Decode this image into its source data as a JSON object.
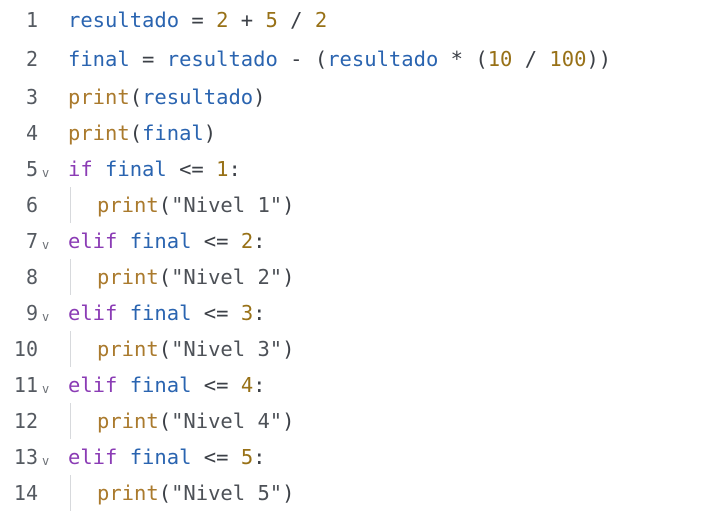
{
  "editor": {
    "lines": [
      {
        "num": "1",
        "fold": "",
        "tokens": [
          {
            "t": "resultado",
            "c": "var"
          },
          {
            "t": " = ",
            "c": "op"
          },
          {
            "t": "2",
            "c": "num"
          },
          {
            "t": " + ",
            "c": "op"
          },
          {
            "t": "5",
            "c": "num"
          },
          {
            "t": " / ",
            "c": "op"
          },
          {
            "t": "2",
            "c": "num"
          }
        ]
      },
      {
        "num": "2",
        "fold": "",
        "tokens": [
          {
            "t": "final",
            "c": "var"
          },
          {
            "t": " = ",
            "c": "op"
          },
          {
            "t": "resultado",
            "c": "var"
          },
          {
            "t": " - ",
            "c": "op"
          },
          {
            "t": "(",
            "c": "punct"
          },
          {
            "t": "resultado",
            "c": "var"
          },
          {
            "t": " * ",
            "c": "op"
          },
          {
            "t": "(",
            "c": "punct"
          },
          {
            "t": "10",
            "c": "num"
          },
          {
            "t": " / ",
            "c": "op"
          },
          {
            "t": "100",
            "c": "num"
          },
          {
            "t": "))",
            "c": "punct"
          }
        ]
      },
      {
        "num": "3",
        "fold": "",
        "tokens": [
          {
            "t": "print",
            "c": "fn"
          },
          {
            "t": "(",
            "c": "punct"
          },
          {
            "t": "resultado",
            "c": "var"
          },
          {
            "t": ")",
            "c": "punct"
          }
        ]
      },
      {
        "num": "4",
        "fold": "",
        "tokens": [
          {
            "t": "print",
            "c": "fn"
          },
          {
            "t": "(",
            "c": "punct"
          },
          {
            "t": "final",
            "c": "var"
          },
          {
            "t": ")",
            "c": "punct"
          }
        ]
      },
      {
        "num": "5",
        "fold": "v",
        "tokens": [
          {
            "t": "if",
            "c": "kw"
          },
          {
            "t": " ",
            "c": "op"
          },
          {
            "t": "final",
            "c": "var"
          },
          {
            "t": " <= ",
            "c": "op"
          },
          {
            "t": "1",
            "c": "num"
          },
          {
            "t": ":",
            "c": "punct"
          }
        ]
      },
      {
        "num": "6",
        "fold": "",
        "indent": true,
        "tokens": [
          {
            "t": "print",
            "c": "fn"
          },
          {
            "t": "(",
            "c": "punct"
          },
          {
            "t": "\"Nivel 1\"",
            "c": "str"
          },
          {
            "t": ")",
            "c": "punct"
          }
        ]
      },
      {
        "num": "7",
        "fold": "v",
        "tokens": [
          {
            "t": "elif",
            "c": "kw"
          },
          {
            "t": " ",
            "c": "op"
          },
          {
            "t": "final",
            "c": "var"
          },
          {
            "t": " <= ",
            "c": "op"
          },
          {
            "t": "2",
            "c": "num"
          },
          {
            "t": ":",
            "c": "punct"
          }
        ]
      },
      {
        "num": "8",
        "fold": "",
        "indent": true,
        "tokens": [
          {
            "t": "print",
            "c": "fn"
          },
          {
            "t": "(",
            "c": "punct"
          },
          {
            "t": "\"Nivel 2\"",
            "c": "str"
          },
          {
            "t": ")",
            "c": "punct"
          }
        ]
      },
      {
        "num": "9",
        "fold": "v",
        "tokens": [
          {
            "t": "elif",
            "c": "kw"
          },
          {
            "t": " ",
            "c": "op"
          },
          {
            "t": "final",
            "c": "var"
          },
          {
            "t": " <= ",
            "c": "op"
          },
          {
            "t": "3",
            "c": "num"
          },
          {
            "t": ":",
            "c": "punct"
          }
        ]
      },
      {
        "num": "10",
        "fold": "",
        "indent": true,
        "tokens": [
          {
            "t": "print",
            "c": "fn"
          },
          {
            "t": "(",
            "c": "punct"
          },
          {
            "t": "\"Nivel 3\"",
            "c": "str"
          },
          {
            "t": ")",
            "c": "punct"
          }
        ]
      },
      {
        "num": "11",
        "fold": "v",
        "tokens": [
          {
            "t": "elif",
            "c": "kw"
          },
          {
            "t": " ",
            "c": "op"
          },
          {
            "t": "final",
            "c": "var"
          },
          {
            "t": " <= ",
            "c": "op"
          },
          {
            "t": "4",
            "c": "num"
          },
          {
            "t": ":",
            "c": "punct"
          }
        ]
      },
      {
        "num": "12",
        "fold": "",
        "indent": true,
        "tokens": [
          {
            "t": "print",
            "c": "fn"
          },
          {
            "t": "(",
            "c": "punct"
          },
          {
            "t": "\"Nivel 4\"",
            "c": "str"
          },
          {
            "t": ")",
            "c": "punct"
          }
        ]
      },
      {
        "num": "13",
        "fold": "v",
        "tokens": [
          {
            "t": "elif",
            "c": "kw"
          },
          {
            "t": " ",
            "c": "op"
          },
          {
            "t": "final",
            "c": "var"
          },
          {
            "t": " <= ",
            "c": "op"
          },
          {
            "t": "5",
            "c": "num"
          },
          {
            "t": ":",
            "c": "punct"
          }
        ]
      },
      {
        "num": "14",
        "fold": "",
        "indent": true,
        "tokens": [
          {
            "t": "print",
            "c": "fn"
          },
          {
            "t": "(",
            "c": "punct"
          },
          {
            "t": "\"Nivel 5\"",
            "c": "str"
          },
          {
            "t": ")",
            "c": "punct"
          }
        ]
      }
    ]
  },
  "colors": {
    "variable": "#2a64b0",
    "number": "#987117",
    "function": "#aa7a2d",
    "keyword": "#8b3cb5",
    "string": "#4d5157",
    "operator": "#3c4047",
    "gutter": "#555a61",
    "background": "#ffffff"
  }
}
